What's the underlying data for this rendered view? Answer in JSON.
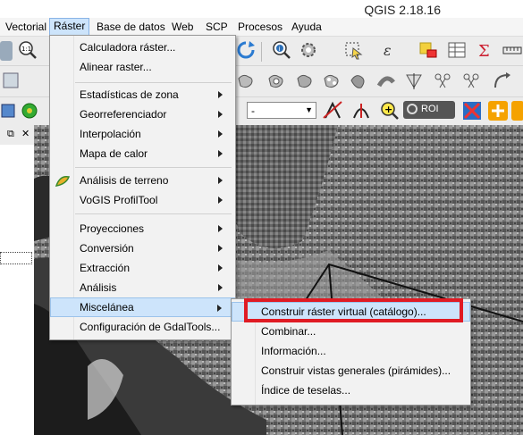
{
  "app": {
    "title": "QGIS 2.18.16"
  },
  "menubar": {
    "items": [
      {
        "label": "Vectorial",
        "id": "vectorial"
      },
      {
        "label": "Ráster",
        "id": "raster"
      },
      {
        "label": "Base de datos",
        "id": "base-de-datos"
      },
      {
        "label": "Web",
        "id": "web"
      },
      {
        "label": "SCP",
        "id": "scp"
      },
      {
        "label": "Procesos",
        "id": "procesos"
      },
      {
        "label": "Ayuda",
        "id": "ayuda"
      }
    ]
  },
  "toolbar": {
    "combo_value": "-",
    "roi_label": "ROI"
  },
  "raster_menu": {
    "items": [
      "Calculadora ráster...",
      "Alinear raster...",
      "Estadísticas de zona",
      "Georreferenciador",
      "Interpolación",
      "Mapa de calor",
      "Análisis de terreno",
      "VoGIS ProfilTool",
      "Proyecciones",
      "Conversión",
      "Extracción",
      "Análisis",
      "Miscelánea",
      "Configuración de GdalTools..."
    ]
  },
  "misc_submenu": {
    "items": [
      "Construir ráster virtual (catálogo)...",
      "Combinar...",
      "Información...",
      "Construir vistas generales (pirámides)...",
      "Índice de teselas..."
    ]
  },
  "colors": {
    "menu_highlight": "#cde4fb",
    "annotation_box": "#e01b24"
  }
}
